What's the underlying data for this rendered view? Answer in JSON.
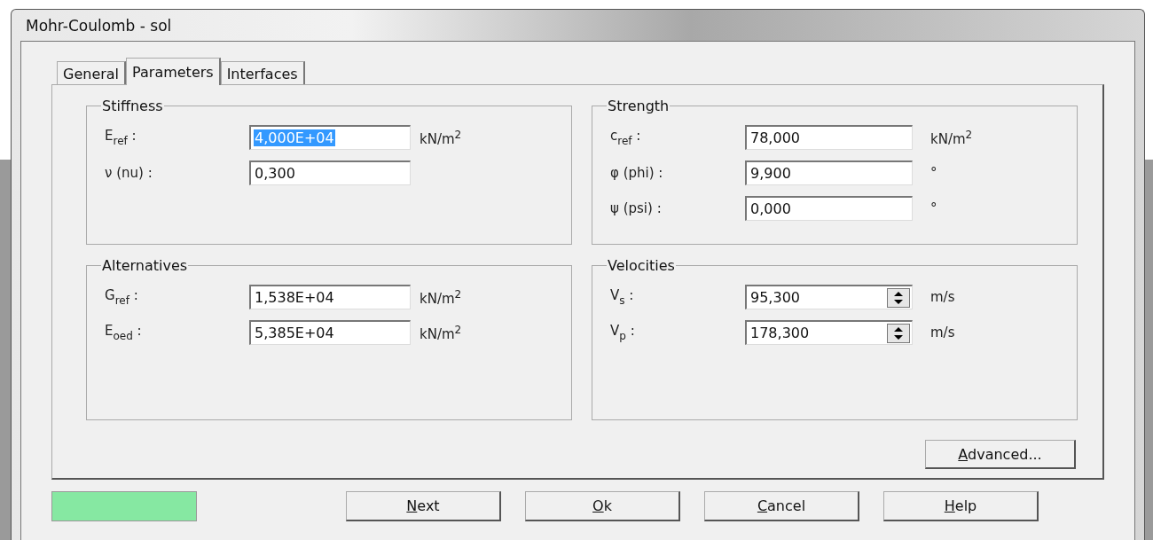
{
  "window": {
    "title": "Mohr-Coulomb - sol"
  },
  "tabs": [
    {
      "label": "General",
      "selected": false
    },
    {
      "label": "Parameters",
      "selected": true
    },
    {
      "label": "Interfaces",
      "selected": false
    }
  ],
  "groups": [
    {
      "title": "Stiffness",
      "fields": [
        {
          "label": "E$_{ref}$ :",
          "value": "4,000E+04",
          "unit": "kN/m$^{2}$",
          "kind": "text",
          "highlighted": true
        },
        {
          "label": "ν (nu) :",
          "value": "0,300",
          "kind": "text",
          "highlighted": false
        }
      ]
    },
    {
      "title": "Strength",
      "fields": [
        {
          "label": "c$_{ref}$ :",
          "value": "78,000",
          "unit": "kN/m$^{2}$",
          "kind": "text",
          "highlighted": false
        },
        {
          "label": "φ (phi) :",
          "value": "9,900",
          "unit": "°",
          "kind": "text",
          "highlighted": false
        },
        {
          "label": "ψ (psi) :",
          "value": "0,000",
          "unit": "°",
          "kind": "text",
          "highlighted": false
        }
      ]
    },
    {
      "title": "Alternatives",
      "fields": [
        {
          "label": "G$_{ref}$ :",
          "value": "1,538E+04",
          "unit": "kN/m$^{2}$",
          "kind": "text",
          "highlighted": false
        },
        {
          "label": "E$_{oed}$ :",
          "value": "5,385E+04",
          "unit": "kN/m$^{2}$",
          "kind": "text",
          "highlighted": false
        }
      ]
    },
    {
      "title": "Velocities",
      "fields": [
        {
          "label": "V$_{s}$ :",
          "value": "95,300",
          "unit": "m/s",
          "kind": "spin",
          "highlighted": false
        },
        {
          "label": "V$_{p}$ :",
          "value": "178,300",
          "unit": "m/s",
          "kind": "spin",
          "highlighted": false
        }
      ]
    }
  ],
  "advanced_button": "Advanced...",
  "buttons": [
    "Next",
    "Ok",
    "Cancel",
    "Help"
  ]
}
